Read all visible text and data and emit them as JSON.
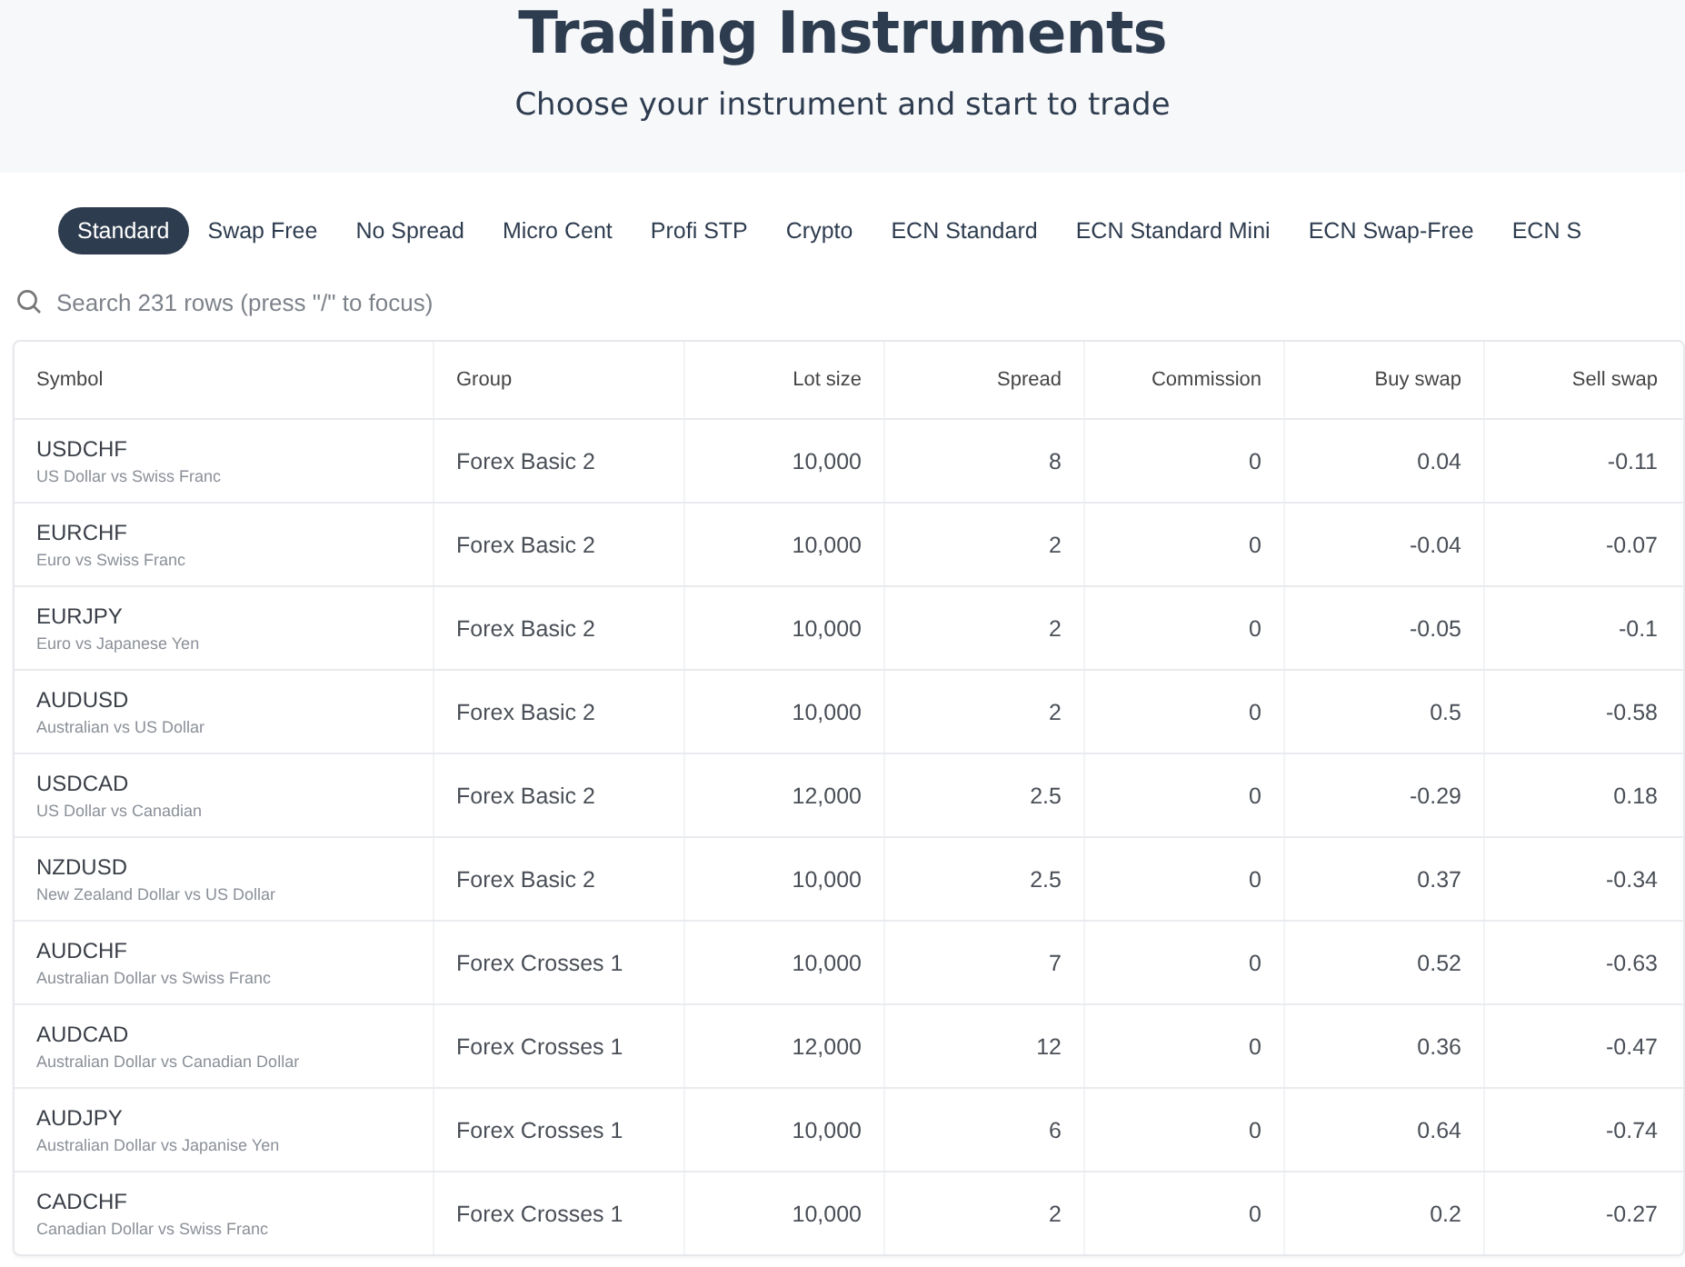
{
  "header": {
    "title": "Trading Instruments",
    "subtitle": "Choose your instrument and start to trade"
  },
  "tabs": [
    {
      "label": "Standard",
      "selected": true
    },
    {
      "label": "Swap Free",
      "selected": false
    },
    {
      "label": "No Spread",
      "selected": false
    },
    {
      "label": "Micro Cent",
      "selected": false
    },
    {
      "label": "Profi STP",
      "selected": false
    },
    {
      "label": "Crypto",
      "selected": false
    },
    {
      "label": "ECN Standard",
      "selected": false
    },
    {
      "label": "ECN Standard Mini",
      "selected": false
    },
    {
      "label": "ECN Swap-Free",
      "selected": false
    },
    {
      "label": "ECN S",
      "selected": false
    }
  ],
  "search": {
    "placeholder": "Search 231 rows (press \"/\" to focus)"
  },
  "table": {
    "columns": [
      "Symbol",
      "Group",
      "Lot size",
      "Spread",
      "Commission",
      "Buy swap",
      "Sell swap"
    ],
    "rows": [
      {
        "symbol": "USDCHF",
        "description": "US Dollar vs Swiss Franc",
        "group": "Forex Basic 2",
        "lot_size": "10,000",
        "spread": "8",
        "commission": "0",
        "buy_swap": "0.04",
        "sell_swap": "-0.11"
      },
      {
        "symbol": "EURCHF",
        "description": "Euro vs Swiss Franc",
        "group": "Forex Basic 2",
        "lot_size": "10,000",
        "spread": "2",
        "commission": "0",
        "buy_swap": "-0.04",
        "sell_swap": "-0.07"
      },
      {
        "symbol": "EURJPY",
        "description": "Euro vs Japanese Yen",
        "group": "Forex Basic 2",
        "lot_size": "10,000",
        "spread": "2",
        "commission": "0",
        "buy_swap": "-0.05",
        "sell_swap": "-0.1"
      },
      {
        "symbol": "AUDUSD",
        "description": "Australian vs US Dollar",
        "group": "Forex Basic 2",
        "lot_size": "10,000",
        "spread": "2",
        "commission": "0",
        "buy_swap": "0.5",
        "sell_swap": "-0.58"
      },
      {
        "symbol": "USDCAD",
        "description": "US Dollar vs Canadian",
        "group": "Forex Basic 2",
        "lot_size": "12,000",
        "spread": "2.5",
        "commission": "0",
        "buy_swap": "-0.29",
        "sell_swap": "0.18"
      },
      {
        "symbol": "NZDUSD",
        "description": "New Zealand Dollar vs US Dollar",
        "group": "Forex Basic 2",
        "lot_size": "10,000",
        "spread": "2.5",
        "commission": "0",
        "buy_swap": "0.37",
        "sell_swap": "-0.34"
      },
      {
        "symbol": "AUDCHF",
        "description": "Australian Dollar vs Swiss Franc",
        "group": "Forex Crosses 1",
        "lot_size": "10,000",
        "spread": "7",
        "commission": "0",
        "buy_swap": "0.52",
        "sell_swap": "-0.63"
      },
      {
        "symbol": "AUDCAD",
        "description": "Australian Dollar vs Canadian Dollar",
        "group": "Forex Crosses 1",
        "lot_size": "12,000",
        "spread": "12",
        "commission": "0",
        "buy_swap": "0.36",
        "sell_swap": "-0.47"
      },
      {
        "symbol": "AUDJPY",
        "description": "Australian Dollar vs Japanise Yen",
        "group": "Forex Crosses 1",
        "lot_size": "10,000",
        "spread": "6",
        "commission": "0",
        "buy_swap": "0.64",
        "sell_swap": "-0.74"
      },
      {
        "symbol": "CADCHF",
        "description": "Canadian Dollar vs Swiss Franc",
        "group": "Forex Crosses 1",
        "lot_size": "10,000",
        "spread": "2",
        "commission": "0",
        "buy_swap": "0.2",
        "sell_swap": "-0.27"
      }
    ]
  }
}
